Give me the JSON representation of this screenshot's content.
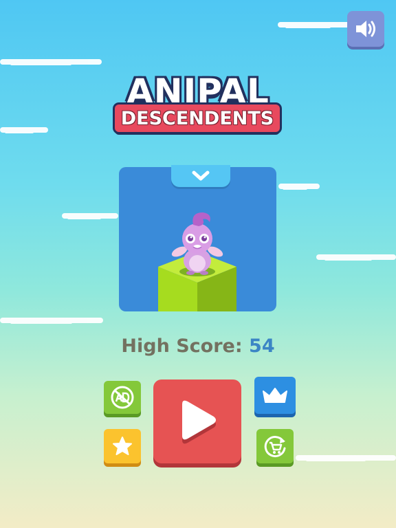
{
  "title": {
    "line1": "ANIPAL",
    "line2": "DESCENDENTS"
  },
  "high_score": {
    "label": "High Score:",
    "value": "54"
  },
  "icons": {
    "sound": "speaker-icon",
    "selector": "chevron-down-icon",
    "no_ads": "no-ads-icon",
    "star": "star-icon",
    "crown": "crown-icon",
    "shop": "cart-restore-icon",
    "play": "play-icon"
  },
  "colors": {
    "play": "#e65353",
    "green": "#84c83a",
    "yellow": "#fbc32e",
    "blue": "#2d8fe2",
    "score_value": "#3b85c5",
    "score_label": "#737160"
  }
}
